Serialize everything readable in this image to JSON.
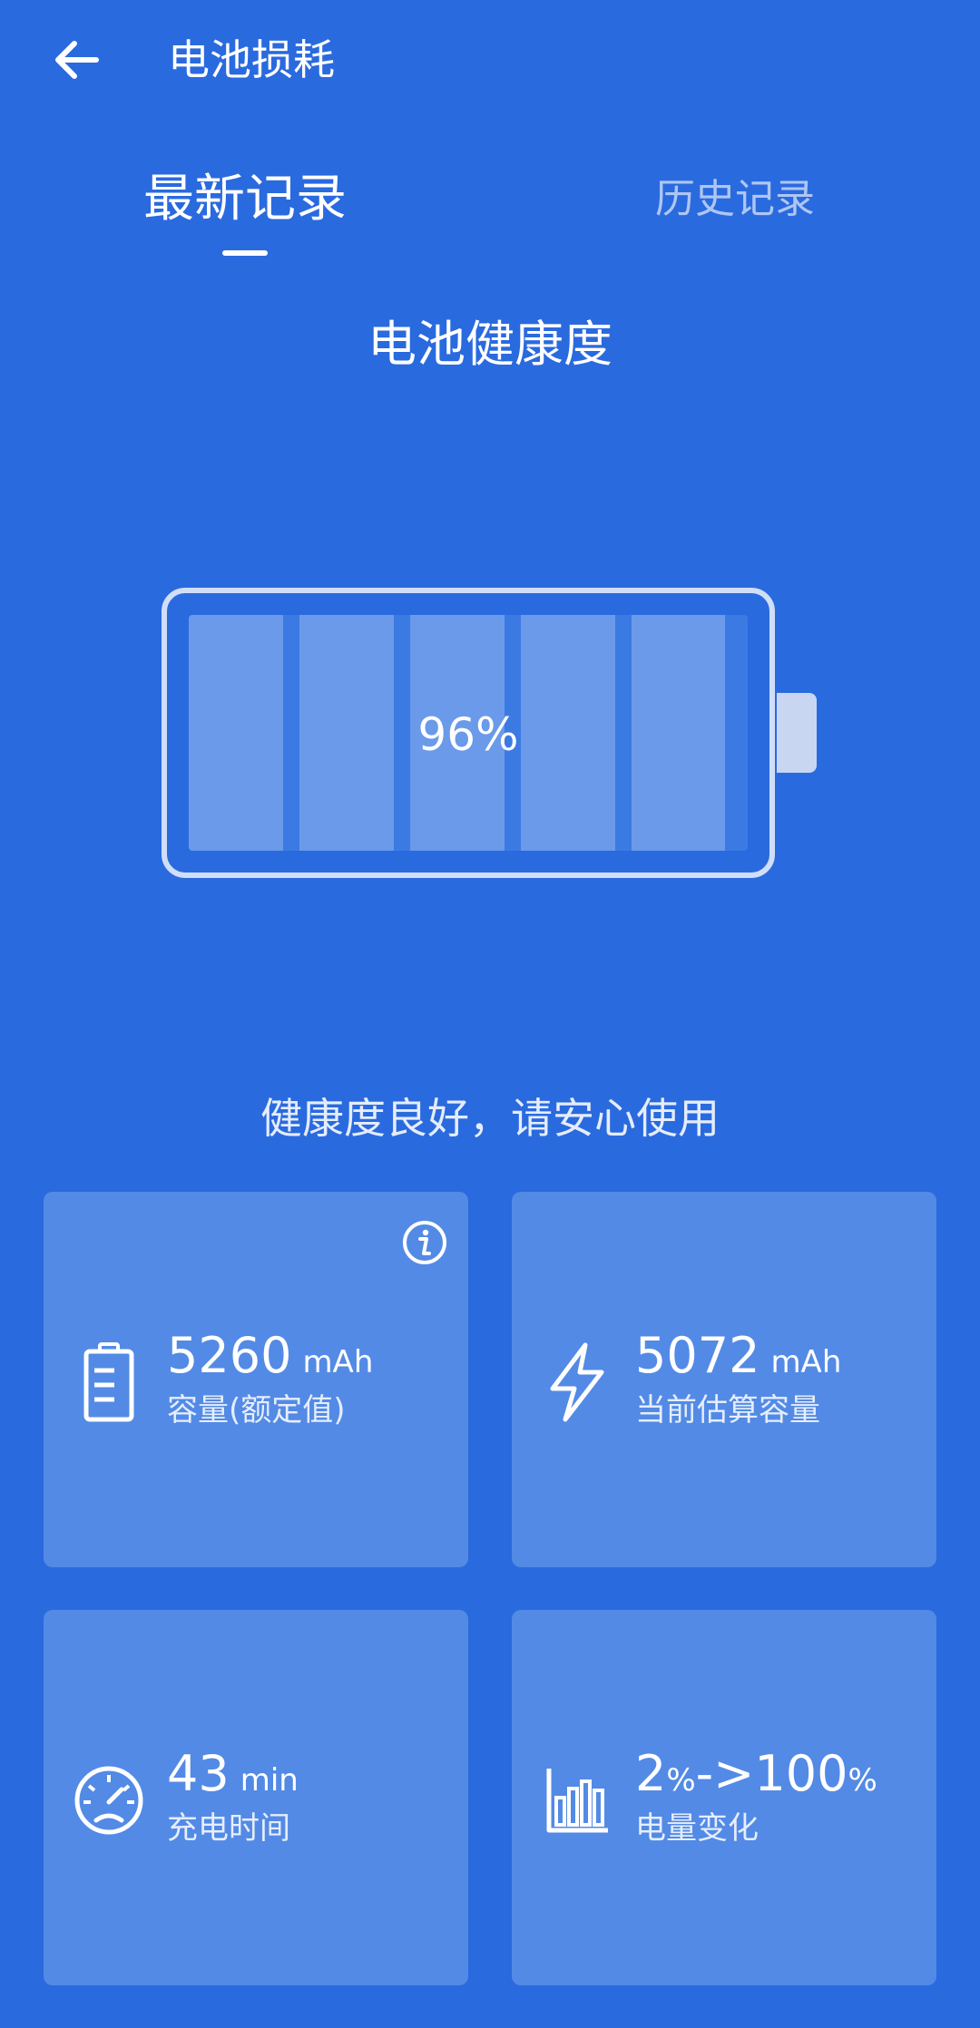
{
  "header": {
    "back_icon": "back-arrow-icon",
    "title": "电池损耗"
  },
  "tabs": [
    {
      "label": "最新记录",
      "active": true
    },
    {
      "label": "历史记录",
      "active": false
    }
  ],
  "health": {
    "title": "电池健康度",
    "percent_value": 96,
    "percent_label": "96%",
    "status": "健康度良好，请安心使用"
  },
  "colors": {
    "background": "#2a6adf",
    "card": "#538ae6",
    "battery_cell": "#6a9ae9",
    "text": "#ffffff"
  },
  "cards": [
    {
      "icon": "battery-document-icon",
      "value": "5260",
      "unit": "mAh",
      "label": "容量(额定值)",
      "has_info": true,
      "info_icon": "info-icon"
    },
    {
      "icon": "lightning-bolt-icon",
      "value": "5072",
      "unit": "mAh",
      "label": "当前估算容量"
    },
    {
      "icon": "speedometer-icon",
      "value": "43",
      "unit": "min",
      "label": "充电时间"
    },
    {
      "icon": "bar-chart-icon",
      "value_from": "2",
      "value_from_unit": "%",
      "arrow": "->",
      "value_to": "100",
      "value_to_unit": "%",
      "label": "电量变化"
    }
  ]
}
